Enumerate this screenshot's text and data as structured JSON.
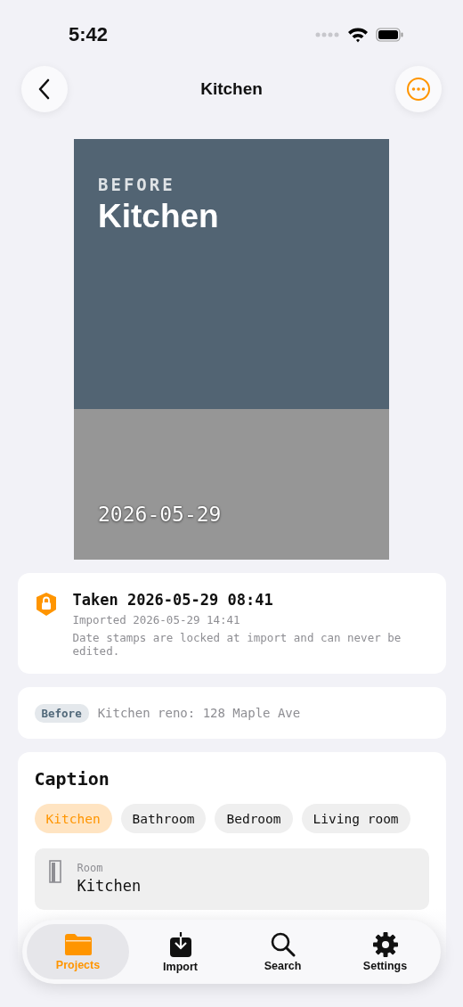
{
  "status_bar": {
    "time": "5:42"
  },
  "nav": {
    "title": "Kitchen"
  },
  "photo": {
    "tag": "BEFORE",
    "title": "Kitchen",
    "date": "2026-05-29"
  },
  "timestamp_card": {
    "taken": "Taken 2026-05-29 08:41",
    "imported": "Imported 2026-05-29 14:41",
    "note": "Date stamps are locked at import and can never be edited."
  },
  "project_card": {
    "badge": "Before",
    "project": "Kitchen reno: 128 Maple Ave"
  },
  "caption": {
    "heading": "Caption",
    "chips": [
      {
        "label": "Kitchen",
        "selected": true
      },
      {
        "label": "Bathroom",
        "selected": false
      },
      {
        "label": "Bedroom",
        "selected": false
      },
      {
        "label": "Living room",
        "selected": false
      }
    ],
    "room_field": {
      "label": "Room",
      "value": "Kitchen"
    }
  },
  "tab_bar": [
    {
      "kind": "folder",
      "label": "Projects",
      "selected": true
    },
    {
      "kind": "import",
      "label": "Import",
      "selected": false
    },
    {
      "kind": "search",
      "label": "Search",
      "selected": false
    },
    {
      "kind": "settings",
      "label": "Settings",
      "selected": false
    }
  ]
}
